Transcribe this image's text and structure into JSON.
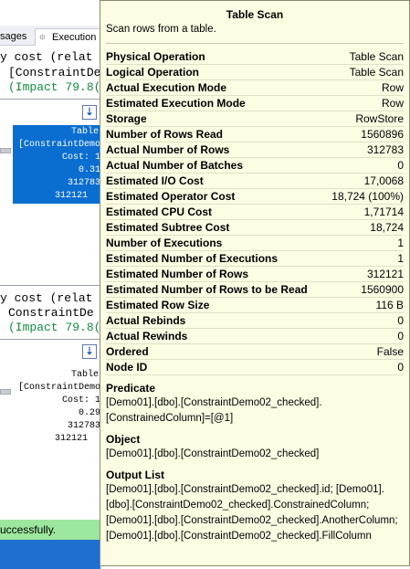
{
  "background": {
    "tabs": [
      {
        "label": "sages"
      },
      {
        "label": "Execution"
      }
    ],
    "query1": {
      "line1": "y cost (relat",
      "line2": "[ConstraintDe",
      "line3": "(Impact 79.8("
    },
    "node1": {
      "label": "Table",
      "line2": "[ConstraintDemo",
      "line3": "Cost: 1",
      "line4": "0.31",
      "line5": "312783",
      "line6": "312121"
    },
    "query2": {
      "line1": "y cost (relat",
      "line2": "ConstraintDe",
      "line3": "(Impact 79.8("
    },
    "node2": {
      "label": "Table",
      "line2": "[ConstraintDemo",
      "line3": "Cost: 1",
      "line4": "0.29",
      "line5": "312783",
      "line6": "312121"
    },
    "status": "uccessfully."
  },
  "tooltip": {
    "title": "Table Scan",
    "description": "Scan rows from a table.",
    "properties": [
      {
        "label": "Physical Operation",
        "value": "Table Scan"
      },
      {
        "label": "Logical Operation",
        "value": "Table Scan"
      },
      {
        "label": "Actual Execution Mode",
        "value": "Row"
      },
      {
        "label": "Estimated Execution Mode",
        "value": "Row"
      },
      {
        "label": "Storage",
        "value": "RowStore"
      },
      {
        "label": "Number of Rows Read",
        "value": "1560896"
      },
      {
        "label": "Actual Number of Rows",
        "value": "312783"
      },
      {
        "label": "Actual Number of Batches",
        "value": "0"
      },
      {
        "label": "Estimated I/O Cost",
        "value": "17,0068"
      },
      {
        "label": "Estimated Operator Cost",
        "value": "18,724 (100%)"
      },
      {
        "label": "Estimated CPU Cost",
        "value": "1,71714"
      },
      {
        "label": "Estimated Subtree Cost",
        "value": "18,724"
      },
      {
        "label": "Number of Executions",
        "value": "1"
      },
      {
        "label": "Estimated Number of Executions",
        "value": "1"
      },
      {
        "label": "Estimated Number of Rows",
        "value": "312121"
      },
      {
        "label": "Estimated Number of Rows to be Read",
        "value": "1560900"
      },
      {
        "label": "Estimated Row Size",
        "value": "116 B"
      },
      {
        "label": "Actual Rebinds",
        "value": "0"
      },
      {
        "label": "Actual Rewinds",
        "value": "0"
      },
      {
        "label": "Ordered",
        "value": "False"
      },
      {
        "label": "Node ID",
        "value": "0"
      }
    ],
    "predicate_heading": "Predicate",
    "predicate": "[Demo01].[dbo].[ConstraintDemo02_checked].[ConstrainedColumn]=[@1]",
    "object_heading": "Object",
    "object": "[Demo01].[dbo].[ConstraintDemo02_checked]",
    "output_heading": "Output List",
    "output": "[Demo01].[dbo].[ConstraintDemo02_checked].id; [Demo01].[dbo].[ConstraintDemo02_checked].ConstrainedColumn; [Demo01].[dbo].[ConstraintDemo02_checked].AnotherColumn; [Demo01].[dbo].[ConstraintDemo02_checked].FillColumn"
  },
  "colors": {
    "tooltip_bg": "#fdfde4",
    "selected_node": "#0a6ed1",
    "impact_text": "#158a40",
    "status_bar": "#9de69d"
  }
}
